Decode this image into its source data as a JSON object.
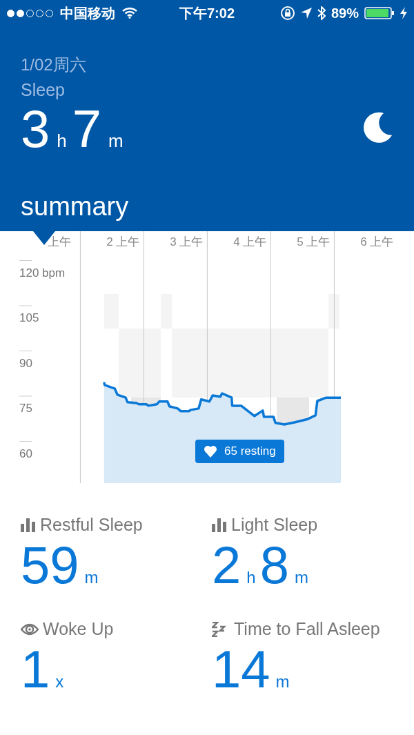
{
  "status_bar": {
    "signal_dots": [
      {
        "on": true
      },
      {
        "on": true
      },
      {
        "on": false
      },
      {
        "on": false
      },
      {
        "on": false
      }
    ],
    "carrier": "中国移动",
    "time": "下午7:02",
    "battery": "89%"
  },
  "header": {
    "date": "1/02周六",
    "title": "Sleep",
    "duration": [
      {
        "value": "3",
        "unit": "h"
      },
      {
        "value": "7",
        "unit": "m"
      }
    ],
    "section": "summary"
  },
  "chart": {
    "resting_label": "65 resting",
    "chart_data": {
      "type": "area",
      "xlim": [
        1,
        6
      ],
      "ylim": [
        60,
        120
      ],
      "xticks": [
        {
          "value": 1,
          "label": "上午"
        },
        {
          "value": 2,
          "label": "2 上午"
        },
        {
          "value": 3,
          "label": "3 上午"
        },
        {
          "value": 4,
          "label": "4 上午"
        },
        {
          "value": 5,
          "label": "5 上午"
        },
        {
          "value": 6,
          "label": "6 上午"
        }
      ],
      "yticks": [
        {
          "value": 120,
          "label": "120 bpm"
        },
        105,
        90,
        75,
        60
      ],
      "x": [
        1.7,
        1.71,
        1.87,
        1.91,
        2.04,
        2.07,
        2.21,
        2.25,
        2.37,
        2.4,
        2.53,
        2.57,
        2.7,
        2.73,
        2.86,
        2.91,
        3.04,
        3.06,
        3.19,
        3.23,
        3.36,
        3.41,
        3.53,
        3.56,
        3.71,
        3.72,
        3.86,
        4.07,
        4.2,
        4.22,
        4.37,
        4.4,
        4.54,
        4.7,
        4.91,
        5.03,
        5.06,
        5.2,
        5.43
      ],
      "series": [
        {
          "color": "#0a78d7",
          "values": [
            83.5,
            82.6,
            81.4,
            79.4,
            78.4,
            76.9,
            76.6,
            76.2,
            76.2,
            75.7,
            76.2,
            77.1,
            77.1,
            75.5,
            74.8,
            73.9,
            73.9,
            74.3,
            74.8,
            77.8,
            77.1,
            79.1,
            78.7,
            79.8,
            78.4,
            75.7,
            75.7,
            72.3,
            74.1,
            72,
            72,
            70,
            69.5,
            70.2,
            71.3,
            72.5,
            77.3,
            78.4,
            78.4
          ]
        }
      ]
    }
  },
  "stats": [
    {
      "kind": "bars",
      "label": "Restful Sleep",
      "parts": [
        {
          "value": "59",
          "unit": "m"
        }
      ]
    },
    {
      "kind": "bars",
      "label": "Light Sleep",
      "parts": [
        {
          "value": "2",
          "unit": "h"
        },
        {
          "value": "8",
          "unit": "m"
        }
      ]
    },
    {
      "kind": "eye",
      "label": "Woke Up",
      "parts": [
        {
          "value": "1",
          "unit": "x"
        }
      ]
    },
    {
      "kind": "zzz",
      "label": "Time to Fall Asleep",
      "parts": [
        {
          "value": "14",
          "unit": "m"
        }
      ]
    }
  ]
}
